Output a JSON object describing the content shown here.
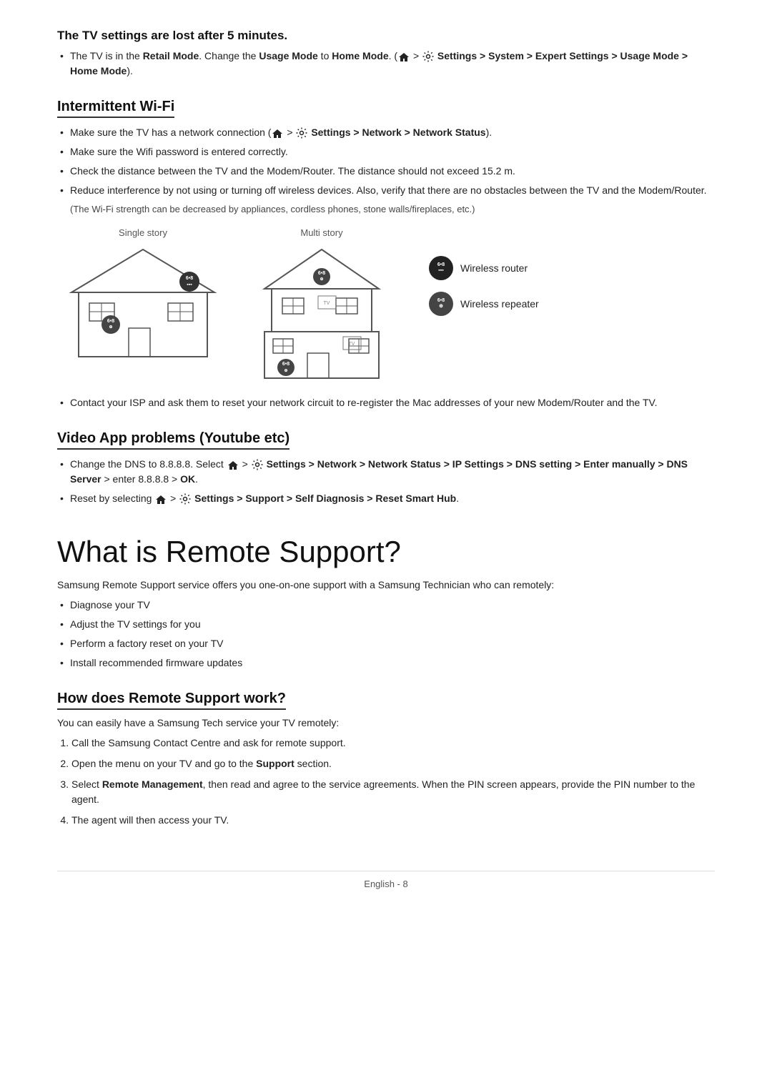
{
  "sections": {
    "tv_settings_lost": {
      "title": "The TV settings are lost after 5 minutes.",
      "bullets": [
        {
          "text": "The TV is in the ",
          "segments": [
            {
              "text": "Retail Mode",
              "bold": true
            },
            {
              "text": ". Change the "
            },
            {
              "text": "Usage Mode",
              "bold": true
            },
            {
              "text": " to "
            },
            {
              "text": "Home Mode",
              "bold": true
            },
            {
              "text": ". ("
            },
            {
              "text": "HOME_ICON"
            },
            {
              "text": " > "
            },
            {
              "text": "SETTINGS_ICON"
            },
            {
              "text": " Settings > System > Expert Settings > Usage Mode > Home Mode",
              "bold": false,
              "partial_bold": true
            },
            {
              "text": ")."
            }
          ]
        }
      ]
    },
    "intermittent_wifi": {
      "title": "Intermittent Wi-Fi",
      "bullets": [
        "Make sure the TV has a network connection (HOME_ICON > SETTINGS_ICON Settings > Network > Network Status).",
        "Make sure the Wifi password is entered correctly.",
        "Check the distance between the TV and the Modem/Router. The distance should not exceed 15.2 m.",
        "Reduce interference by not using or turning off wireless devices. Also, verify that there are no obstacles between the TV and the Modem/Router."
      ],
      "note": "(The Wi-Fi strength can be decreased by appliances, cordless phones, stone walls/fireplaces, etc.)",
      "diagram": {
        "single_label": "Single story",
        "multi_label": "Multi story",
        "legend": {
          "router_label": "Wireless router",
          "repeater_label": "Wireless repeater",
          "router_text": "6•8",
          "repeater_text": "6•8"
        }
      },
      "contact_bullet": "Contact your ISP and ask them to reset your network circuit to re-register the Mac addresses of your new Modem/Router and the TV."
    },
    "video_app_problems": {
      "title": "Video App problems (Youtube etc)",
      "bullets": [
        {
          "segments": [
            {
              "text": "Change the DNS to 8.8.8.8. Select "
            },
            {
              "text": "HOME_ICON"
            },
            {
              "text": " > "
            },
            {
              "text": "SETTINGS_ICON"
            },
            {
              "text": " Settings > Network > Network Status > IP Settings > DNS setting > Enter manually > DNS Server",
              "bold": true
            },
            {
              "text": " > enter 8.8.8.8 > "
            },
            {
              "text": "OK",
              "bold": true
            },
            {
              "text": "."
            }
          ]
        },
        {
          "segments": [
            {
              "text": "Reset by selecting "
            },
            {
              "text": "HOME_ICON"
            },
            {
              "text": " > "
            },
            {
              "text": "SETTINGS_ICON"
            },
            {
              "text": " Settings > Support > Self Diagnosis > Reset Smart Hub",
              "bold": true
            },
            {
              "text": "."
            }
          ]
        }
      ]
    },
    "remote_support": {
      "title": "What is Remote Support?",
      "intro": "Samsung Remote Support service offers you one-on-one support with a Samsung Technician who can remotely:",
      "bullets": [
        "Diagnose your TV",
        "Adjust the TV settings for you",
        "Perform a factory reset on your TV",
        "Install recommended firmware updates"
      ]
    },
    "how_remote_support": {
      "title": "How does Remote Support work?",
      "intro": "You can easily have a Samsung Tech service your TV remotely:",
      "steps": [
        "Call the Samsung Contact Centre and ask for remote support.",
        {
          "segments": [
            {
              "text": "Open the menu on your TV and go to the "
            },
            {
              "text": "Support",
              "bold": true
            },
            {
              "text": " section."
            }
          ]
        },
        {
          "segments": [
            {
              "text": "Select "
            },
            {
              "text": "Remote Management",
              "bold": true
            },
            {
              "text": ", then read and agree to the service agreements. When the PIN screen appears, provide the PIN number to the agent."
            }
          ]
        },
        "The agent will then access your TV."
      ]
    }
  },
  "footer": {
    "text": "English - 8"
  }
}
